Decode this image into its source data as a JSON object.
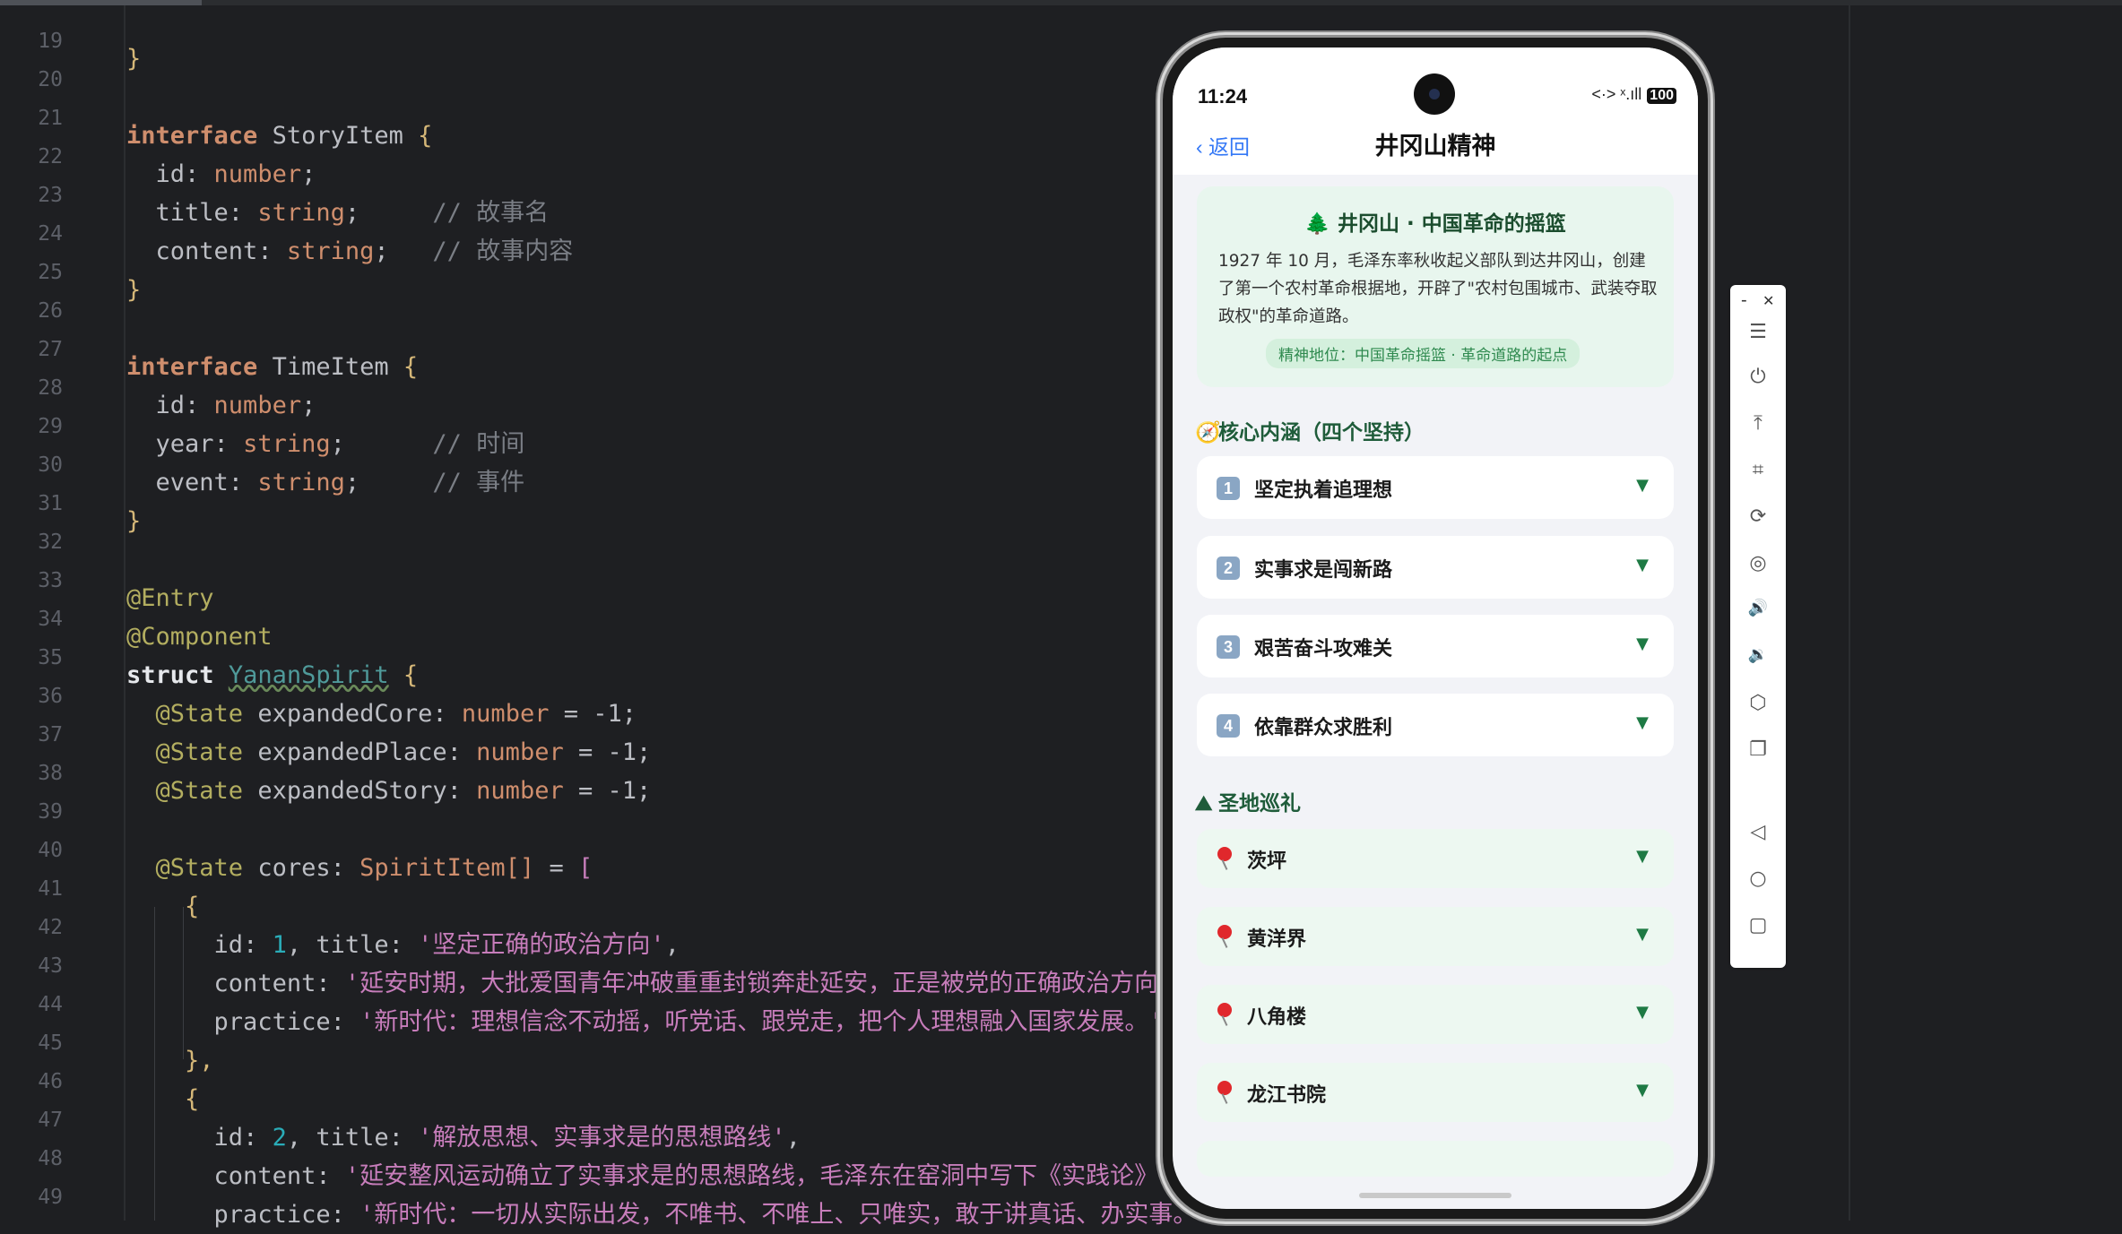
{
  "editor": {
    "lines": [
      {
        "n": "19"
      },
      {
        "n": "20"
      },
      {
        "n": "21"
      },
      {
        "n": "22"
      },
      {
        "n": "23"
      },
      {
        "n": "24"
      },
      {
        "n": "25"
      },
      {
        "n": "26"
      },
      {
        "n": "27"
      },
      {
        "n": "28"
      },
      {
        "n": "29"
      },
      {
        "n": "30"
      },
      {
        "n": "31"
      },
      {
        "n": "32"
      },
      {
        "n": "33"
      },
      {
        "n": "34"
      },
      {
        "n": "35"
      },
      {
        "n": "36"
      },
      {
        "n": "37"
      },
      {
        "n": "38"
      },
      {
        "n": "39"
      },
      {
        "n": "40"
      },
      {
        "n": "41"
      },
      {
        "n": "42"
      },
      {
        "n": "43"
      },
      {
        "n": "44"
      },
      {
        "n": "45"
      },
      {
        "n": "46"
      },
      {
        "n": "47"
      },
      {
        "n": "48"
      },
      {
        "n": "49"
      }
    ],
    "tok": {
      "brace_close": "}",
      "brace_open": "{",
      "interface": "interface",
      "story_item": "StoryItem",
      "time_item": "TimeItem",
      "id": "id",
      "title": "title",
      "content": "content",
      "year": "year",
      "event": "event",
      "number": "number",
      "string": "string",
      "semi": ";",
      "colon": ": ",
      "cm_story_title": "// 故事名",
      "cm_story_content": "// 故事内容",
      "cm_time": "// 时间",
      "cm_event": "// 事件",
      "entry": "@Entry",
      "component": "@Component",
      "struct": "struct",
      "yanan": "YananSpirit",
      "state": "@State",
      "expanded_core": "expandedCore",
      "expanded_place": "expandedPlace",
      "expanded_story": "expandedStory",
      "eq_neg1": " = -1;",
      "cores": "cores",
      "spirit_type": "SpiritItem[]",
      "eq": " = ",
      "bracket_open": "[",
      "brace_close_comma": "},",
      "practice": "practice",
      "one": "1",
      "two": "2",
      "comma": ",",
      "s_title1": "'坚定正确的政治方向'",
      "s_content1": "'延安时期，大批爱国青年冲破重重封锁奔赴延安，正是被党的正确政治方向所感召",
      "s_practice1": "'新时代：理想信念不动摇，听党话、跟党走，把个人理想融入国家发展。'",
      "s_title2": "'解放思想、实事求是的思想路线'",
      "s_content2": "'延安整风运动确立了实事求是的思想路线，毛泽东在窑洞中写下《实践论》《矛盾",
      "s_practice2": "'新时代：一切从实际出发，不唯书、不唯上、只唯实，敢于讲真话、办实事。'"
    }
  },
  "phone": {
    "status": {
      "time": "11:24",
      "signal": "<·> ˣ.ıll",
      "battery": "100"
    },
    "nav": {
      "back": "‹ 返回",
      "title": "井冈山精神"
    },
    "hero": {
      "icon": "tree-icon",
      "title": "🌲 井冈山 · 中国革命的摇篮",
      "text": "1927 年 10 月，毛泽东率秋收起义部队到达井冈山，创建了第一个农村革命根据地，开辟了\"农村包围城市、武装夺取政权\"的革命道路。",
      "tag": "精神地位：中国革命摇篮 · 革命道路的起点"
    },
    "core_section": {
      "icon": "compass-icon",
      "icon_glyph": "🧭",
      "title": "核心内涵（四个坚持）"
    },
    "cores": [
      {
        "n": "1",
        "label": "坚定执着追理想"
      },
      {
        "n": "2",
        "label": "实事求是闯新路"
      },
      {
        "n": "3",
        "label": "艰苦奋斗攻难关"
      },
      {
        "n": "4",
        "label": "依靠群众求胜利"
      }
    ],
    "place_section": {
      "icon": "mountain-icon",
      "icon_glyph": "⛰",
      "title": "圣地巡礼"
    },
    "places": [
      {
        "label": "茨坪"
      },
      {
        "label": "黄洋界"
      },
      {
        "label": "八角楼"
      },
      {
        "label": "龙江书院"
      }
    ],
    "chevron": "▼"
  },
  "toolbar": {
    "minimize": "-",
    "close": "✕",
    "icons": [
      "menu-icon",
      "power-icon",
      "pin-top-icon",
      "crop-icon",
      "rotate-icon",
      "screen-record-icon",
      "volume-up-icon",
      "volume-down-icon",
      "fold-icon",
      "screenshot-icon",
      "back-icon",
      "home-icon",
      "recent-apps-icon"
    ],
    "glyphs": {
      "menu": "☰",
      "power": "⏻",
      "pin": "⤒",
      "crop": "⌗",
      "rotate": "⟳",
      "record": "◎",
      "vol_up": "🔊",
      "vol_down": "🔉",
      "fold": "⬡",
      "shot": "❐",
      "back": "◁",
      "home": "○",
      "recent": "▢"
    }
  }
}
